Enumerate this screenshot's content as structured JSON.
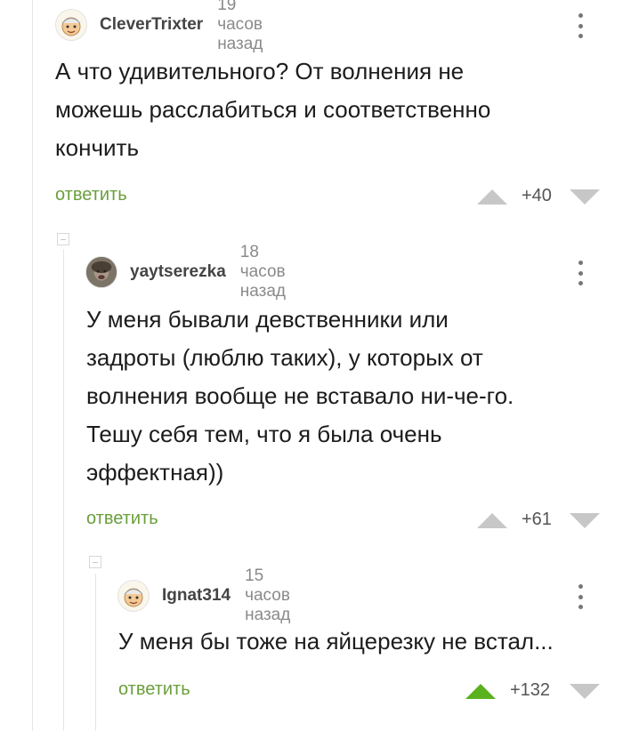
{
  "comments": [
    {
      "username": "CleverTrixter",
      "time": "19 часов назад",
      "text_lines": [
        "А что удивительного? От волнения не",
        "можешь расслабиться и соответственно",
        "кончить"
      ],
      "reply_label": "ответить",
      "score": "+40",
      "upvoted": false,
      "avatar": "cartoon-face-avatar"
    },
    {
      "username": "yaytserezka",
      "time": "18 часов назад",
      "text_lines": [
        "У меня бывали девственники или",
        "задроты (люблю таких), у которых от",
        "волнения вообще не вставало ни-че-го.",
        "Тешу себя тем, что я была очень",
        "эффектная))"
      ],
      "reply_label": "ответить",
      "score": "+61",
      "upvoted": false,
      "avatar": "photo-avatar"
    },
    {
      "username": "Ignat314",
      "time": "15 часов назад",
      "text_lines": [
        "У меня бы тоже на яйцерезку не встал..."
      ],
      "reply_label": "ответить",
      "score": "+132",
      "upvoted": true,
      "avatar": "cartoon-face-avatar"
    }
  ],
  "colors": {
    "reply": "#6a9f3c",
    "upvote_active": "#5ab11e",
    "arrow_inactive": "#c7c7c7"
  }
}
